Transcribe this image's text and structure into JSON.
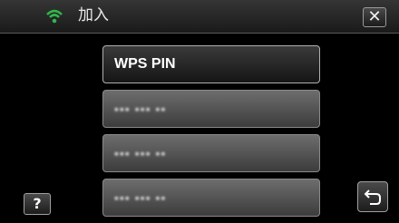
{
  "header": {
    "title": "加入",
    "wifi_icon": "wifi-icon",
    "close_icon": "close-icon",
    "close_label": "✕"
  },
  "list": {
    "items": [
      {
        "label": "WPS PIN",
        "selected": true
      },
      {
        "label": "▪▪▪ ▪▪▪ ▪▪",
        "masked": true
      },
      {
        "label": "▪▪▪ ▪▪▪ ▪▪",
        "masked": true
      },
      {
        "label": "▪▪▪ ▪▪▪ ▪▪",
        "masked": true
      }
    ]
  },
  "footer": {
    "help_label": "?",
    "help_icon": "help-icon",
    "back_icon": "back-arrow-icon"
  },
  "colors": {
    "wifi": "#2fb84a",
    "button_bg": "#555555",
    "background": "#000000"
  }
}
